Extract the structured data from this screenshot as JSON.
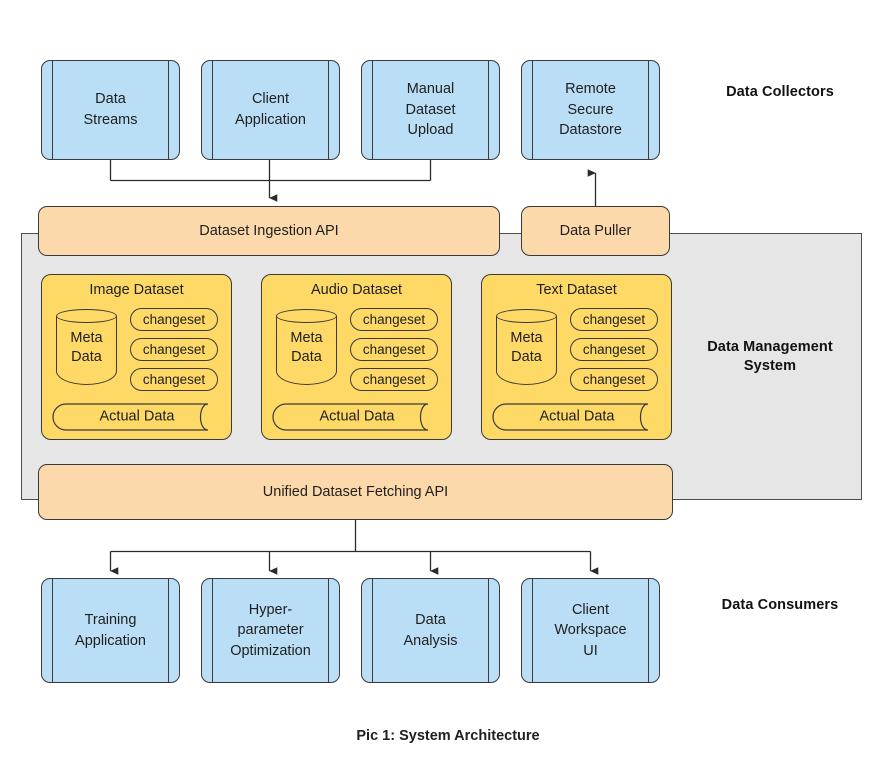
{
  "figure": {
    "caption": "Pic 1: System Architecture"
  },
  "colors": {
    "collector_fill": "#b9def5",
    "api_fill": "#fcd9aa",
    "dataset_fill": "#ffd966",
    "group_fill": "#e6e6e6",
    "stroke": "#3a3a3a"
  },
  "groups": [
    {
      "id": "data-collectors",
      "label": "Data Collectors"
    },
    {
      "id": "data-management-system",
      "label": "Data Management\nSystem"
    },
    {
      "id": "data-consumers",
      "label": "Data Consumers"
    }
  ],
  "collectors": [
    {
      "id": "data-streams",
      "label": "Data\nStreams"
    },
    {
      "id": "client-application",
      "label": "Client\nApplication"
    },
    {
      "id": "manual-dataset-upload",
      "label": "Manual\nDataset\nUpload"
    },
    {
      "id": "remote-secure-datastore",
      "label": "Remote\nSecure\nDatastore"
    }
  ],
  "apis": [
    {
      "id": "dataset-ingestion-api",
      "label": "Dataset Ingestion API"
    },
    {
      "id": "data-puller",
      "label": "Data Puller"
    },
    {
      "id": "unified-dataset-fetching-api",
      "label": "Unified Dataset Fetching API"
    }
  ],
  "datasets": [
    {
      "id": "image-dataset",
      "title": "Image Dataset",
      "metadata_label": "Meta\nData",
      "changesets": [
        "changeset",
        "changeset",
        "changeset"
      ],
      "actual_data_label": "Actual Data"
    },
    {
      "id": "audio-dataset",
      "title": "Audio Dataset",
      "metadata_label": "Meta\nData",
      "changesets": [
        "changeset",
        "changeset",
        "changeset"
      ],
      "actual_data_label": "Actual Data"
    },
    {
      "id": "text-dataset",
      "title": "Text Dataset",
      "metadata_label": "Meta\nData",
      "changesets": [
        "changeset",
        "changeset",
        "changeset"
      ],
      "actual_data_label": "Actual Data"
    }
  ],
  "consumers": [
    {
      "id": "training-application",
      "label": "Training\nApplication"
    },
    {
      "id": "hyperparameter-optimization",
      "label": "Hyper-\nparameter\nOptimization"
    },
    {
      "id": "data-analysis",
      "label": "Data\nAnalysis"
    },
    {
      "id": "client-workspace-ui",
      "label": "Client\nWorkspace\nUI"
    }
  ]
}
